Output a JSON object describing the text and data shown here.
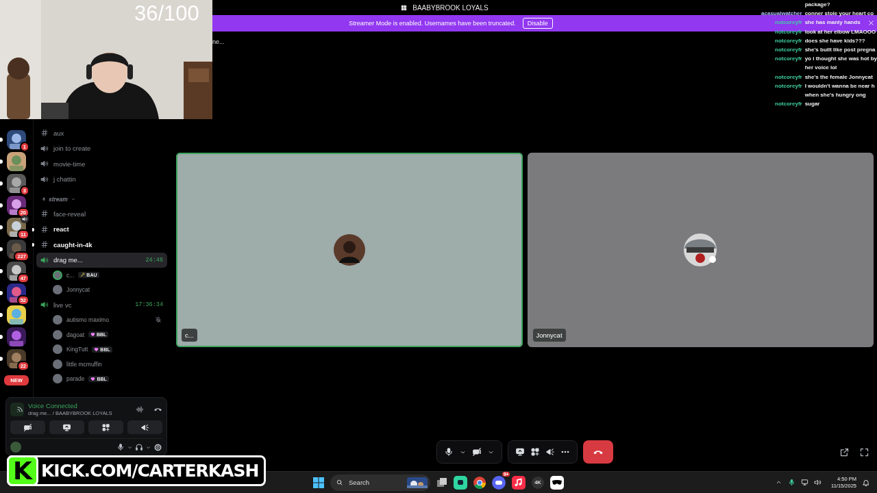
{
  "window": {
    "title": "BAABYBROOK LOYALS"
  },
  "streamer_banner": {
    "text": "Streamer Mode is enabled. Usernames have been truncated.",
    "button": "Disable"
  },
  "webcam": {
    "counter": "36/100"
  },
  "chat": [
    {
      "message": "package?"
    },
    {
      "user": "acasualwatcher",
      "color": "#b3c2ff",
      "message": "conner stole your heart co"
    },
    {
      "user": "notcoreyfr",
      "color": "#3fcfa2",
      "message": "she has manly hands"
    },
    {
      "user": "notcoreyfr",
      "color": "#3fcfa2",
      "message": "look at her elbow LMAOOO"
    },
    {
      "user": "notcoreyfr",
      "color": "#3fcfa2",
      "message": "does she have kids???"
    },
    {
      "user": "notcoreyfr",
      "color": "#3fcfa2",
      "message": "she's built like post pregna"
    },
    {
      "user": "notcoreyfr",
      "color": "#3fcfa2",
      "lines": [
        "yo i thought she was hot by",
        "her voice lol"
      ]
    },
    {
      "user": "notcoreyfr",
      "color": "#3fcfa2",
      "message": "she's the female Jonnycat"
    },
    {
      "user": "notcoreyfr",
      "color": "#3fcfa2",
      "lines": [
        "I wouldn't wanna be near h",
        "when she's hungry ong"
      ]
    },
    {
      "user": "notcoreyfr",
      "color": "#3fcfa2",
      "message": "sugar"
    }
  ],
  "partial_text": "ne...",
  "servers": [
    {
      "badge": "1",
      "voice": false
    },
    {
      "voice": false
    },
    {
      "badge": "3",
      "voice": false
    },
    {
      "badge": "20",
      "voice": false
    },
    {
      "badge": "11",
      "voice": true
    },
    {
      "badge": "227",
      "voice": false
    },
    {
      "badge": "47",
      "voice": false
    },
    {
      "badge": "52",
      "voice": false
    },
    {
      "voice": false
    },
    {
      "voice": false
    },
    {
      "badge": "22",
      "voice": false
    }
  ],
  "new_badge": "NEW",
  "channels": [
    {
      "kind": "text",
      "name": "aux",
      "unread": false,
      "selected": false
    },
    {
      "kind": "voice",
      "name": "join to create",
      "active": false,
      "selected": false
    },
    {
      "kind": "voice",
      "name": "movie-time",
      "active": false,
      "selected": false
    },
    {
      "kind": "voice",
      "name": "j chattin",
      "active": false,
      "selected": false
    },
    {
      "kind": "category",
      "name": "stream",
      "expanded": true
    },
    {
      "kind": "text",
      "name": "face-reveal",
      "unread": false,
      "selected": false
    },
    {
      "kind": "text",
      "name": "react",
      "unread": true,
      "selected": false
    },
    {
      "kind": "text",
      "name": "caught-in-4k",
      "unread": true,
      "selected": false
    },
    {
      "kind": "voice",
      "name": "drag me...",
      "active": true,
      "selected": true,
      "timer": "24:46",
      "members": [
        {
          "name": "c...",
          "tag": {
            "text": "BAU",
            "kind": "sword"
          },
          "speaking": true,
          "muted": false
        },
        {
          "name": "Jonnycat",
          "speaking": false,
          "muted": false
        }
      ]
    },
    {
      "kind": "voice",
      "name": "live vc",
      "active": true,
      "selected": false,
      "timer": "17:36:34",
      "members": [
        {
          "name": "autismo maximo",
          "speaking": false,
          "muted": true
        },
        {
          "name": "dagoat",
          "tag": {
            "text": "BBL",
            "kind": "heart"
          },
          "speaking": false,
          "muted": false
        },
        {
          "name": "KingTutt",
          "tag": {
            "text": "BBL",
            "kind": "heart"
          },
          "speaking": false,
          "muted": false
        },
        {
          "name": "little mcmuffin",
          "speaking": false,
          "muted": false
        },
        {
          "name": "parade",
          "tag": {
            "text": "BBL",
            "kind": "heart"
          },
          "speaking": false,
          "muted": false
        }
      ]
    }
  ],
  "voice_panel": {
    "status": "Voice Connected",
    "location": "drag me... / BAABYBROOK LOYALS"
  },
  "tiles": [
    {
      "name": "c...",
      "speaking": true,
      "color": "#9eacaa"
    },
    {
      "name": "Jonnycat",
      "speaking": false,
      "color": "#7b7b7d"
    }
  ],
  "kick_banner": {
    "logo": "K",
    "text": "KICK.COM/CARTERKASH"
  },
  "taskbar": {
    "search_placeholder": "Search",
    "chat_badge": "9+",
    "app_label": "4K",
    "time": "4:50 PM",
    "date": "11/15/2025"
  }
}
